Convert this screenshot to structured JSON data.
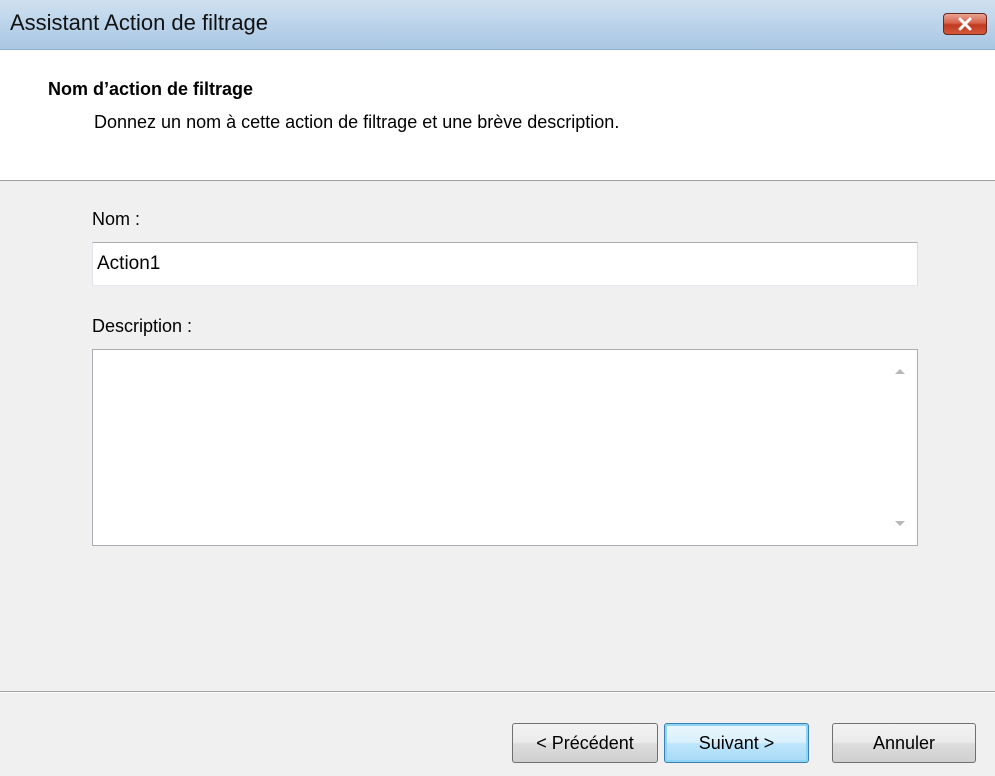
{
  "window": {
    "title": "Assistant Action de filtrage"
  },
  "header": {
    "title": "Nom d’action de filtrage",
    "subtitle": "Donnez un nom à cette action de filtrage et une brève description."
  },
  "form": {
    "name_label": "Nom :",
    "name_value": "Action1",
    "description_label": "Description :",
    "description_value": ""
  },
  "buttons": {
    "previous": "< Précédent",
    "next": "Suivant >",
    "cancel": "Annuler"
  },
  "colors": {
    "titlebar": "#bdd5eb",
    "close_button": "#c0391f",
    "dialog_background": "#f0f0f0",
    "default_button_border": "#3c7fb1"
  },
  "icons": {
    "close": "close-x-icon",
    "scroll_up": "scroll-up-arrow-icon",
    "scroll_down": "scroll-down-arrow-icon"
  }
}
